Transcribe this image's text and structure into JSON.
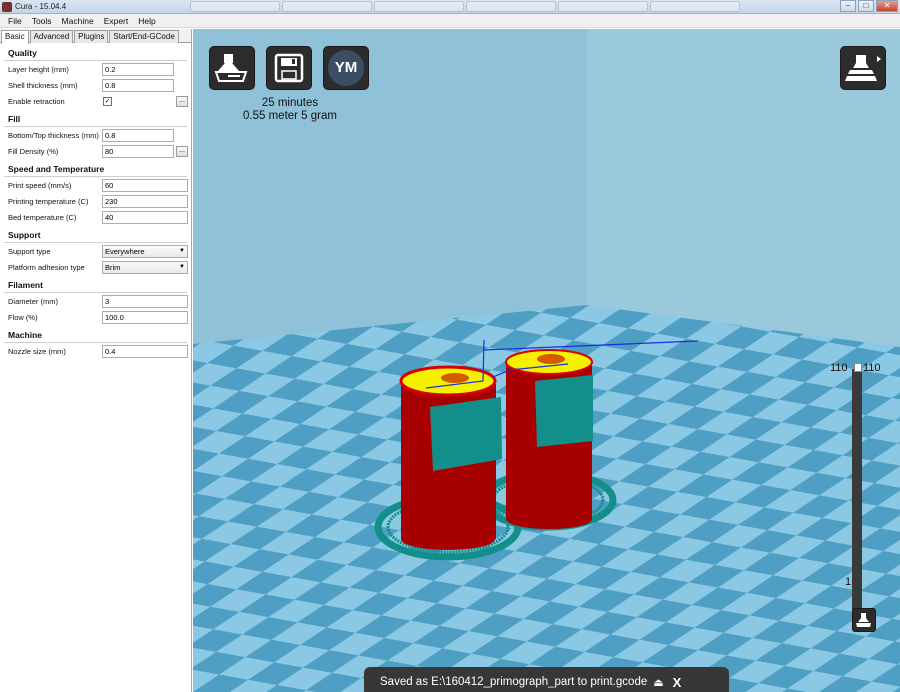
{
  "window": {
    "title": "Cura - 15.04.4",
    "controls": [
      "–",
      "□",
      "✕"
    ]
  },
  "menu": [
    "File",
    "Tools",
    "Machine",
    "Expert",
    "Help"
  ],
  "tabs": [
    "Basic",
    "Advanced",
    "Plugins",
    "Start/End-GCode"
  ],
  "sections": {
    "quality": {
      "title": "Quality",
      "layer_height": {
        "label": "Layer height (mm)",
        "value": "0.2"
      },
      "shell_thickness": {
        "label": "Shell thickness (mm)",
        "value": "0.8"
      },
      "retraction": {
        "label": "Enable retraction",
        "checked": "✓",
        "more": "..."
      }
    },
    "fill": {
      "title": "Fill",
      "bottom_top": {
        "label": "Bottom/Top thickness (mm)",
        "value": "0.8"
      },
      "density": {
        "label": "Fill Density (%)",
        "value": "80",
        "more": "..."
      }
    },
    "speed": {
      "title": "Speed and Temperature",
      "print_speed": {
        "label": "Print speed (mm/s)",
        "value": "60"
      },
      "print_temp": {
        "label": "Printing temperature (C)",
        "value": "230"
      },
      "bed_temp": {
        "label": "Bed temperature (C)",
        "value": "40"
      }
    },
    "support": {
      "title": "Support",
      "type": {
        "label": "Support type",
        "value": "Everywhere"
      },
      "adhesion": {
        "label": "Platform adhesion type",
        "value": "Brim"
      }
    },
    "filament": {
      "title": "Filament",
      "diameter": {
        "label": "Diameter (mm)",
        "value": "3"
      },
      "flow": {
        "label": "Flow (%)",
        "value": "100.0"
      }
    },
    "machine": {
      "title": "Machine",
      "nozzle": {
        "label": "Nozzle size (mm)",
        "value": "0.4"
      }
    }
  },
  "viewport": {
    "icons": {
      "load": "load-model-icon",
      "save": "save-gcode-icon",
      "ym": "YM",
      "view_mode": "view-mode-icon",
      "layer_view": "layer-view-icon"
    },
    "print_time": "25 minutes",
    "print_material": "0.55 meter 5 gram",
    "layer_max_left": "110",
    "layer_max_right": "110",
    "layer_min": "1",
    "toast_text": "Saved as E:\\160412_primograph_part to print.gcode",
    "toast_close": "X",
    "colors": {
      "floor_light": "#8ac8e4",
      "floor_dark": "#4f9ec4",
      "wall": "#93c3d6",
      "model_red": "#a80000",
      "support_teal": "#138f8b",
      "top_yellow": "#f4f000"
    }
  }
}
